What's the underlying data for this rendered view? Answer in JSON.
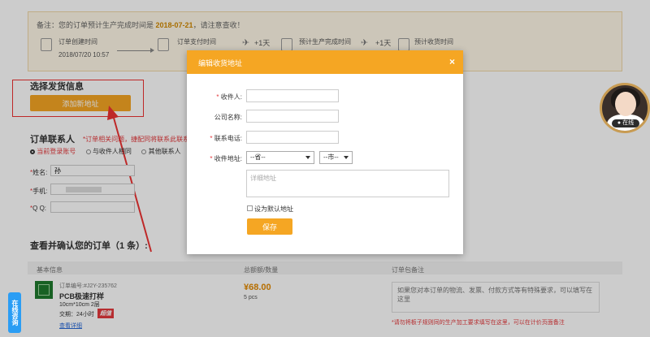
{
  "notice": {
    "prefix": "备注：您的订单预计生产完成时间是 ",
    "date": "2018-07-21",
    "suffix": "，请注意查收！"
  },
  "steps": [
    {
      "title": "订单创建时间",
      "date": "2018/07/20 10:57"
    },
    {
      "title": "订单支付时间",
      "date": ""
    },
    {
      "title": "预计生产完成时间",
      "date": ""
    },
    {
      "title": "预计收货时间",
      "date": ""
    }
  ],
  "step_gaps": [
    "+1天",
    "+1天",
    "+1天"
  ],
  "shipping": {
    "title": "选择发货信息",
    "add_button": "添加新地址"
  },
  "contact": {
    "title": "订单联系人",
    "hint": "*订单相关问题，捷配同将联系此联系人",
    "options": [
      "当前登录账号",
      "与收件人相同",
      "其他联系人"
    ],
    "name_label": "姓名:",
    "name_value": "孙",
    "phone_label": "手机:",
    "qq_label": "Q Q:"
  },
  "orders": {
    "title": "查看并确认您的订单（1 条）:",
    "col_basic": "基本信息",
    "col_total": "总额额/数量",
    "col_memo": "订单包备注",
    "order_no": "订单编号:#J2Y-235762",
    "product": "PCB极速打样",
    "size": "10cm*10cm 2层",
    "lead": "交期：24小时",
    "lead_badge": "超值",
    "view_detail": "查看详细",
    "price": "¥68.00",
    "qty": "5 pcs",
    "memo_placeholder": "如果您对本订单的物流、发票、付款方式等有特殊要求，可以填写在这里",
    "memo_hint": "*请勿将板子规则同的生产加工要求填写在这里，可以在计价页面备注"
  },
  "modal": {
    "title": "编辑收货地址",
    "close": "×",
    "recipient_label": "收件人:",
    "company_label": "公司名称:",
    "phone_label": "联系电话:",
    "address_label": "收件地址:",
    "province": "--省--",
    "city": "--市--",
    "detail_placeholder": "详细地址",
    "default_label": "设为默认地址",
    "save": "保存"
  },
  "service": {
    "button": "在线",
    "chat_tab": "在线咨询"
  }
}
